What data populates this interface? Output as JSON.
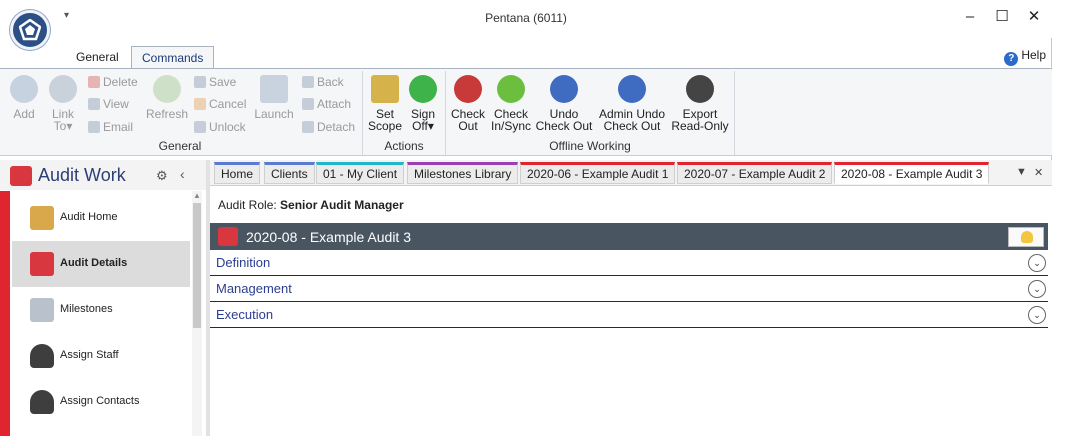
{
  "window": {
    "title": "Pentana (6011)",
    "qat_arrow": "▾",
    "minimize": "–",
    "maximize": "☐",
    "close": "✕"
  },
  "ribbon_tabs": [
    {
      "label": "General"
    },
    {
      "label": "Commands",
      "active": true
    }
  ],
  "help": {
    "label": "Help",
    "icon": "?"
  },
  "ribbon": {
    "general": {
      "label": "General",
      "add": "Add",
      "link_to": "Link To▾",
      "delete": "Delete",
      "view": "View",
      "email": "Email",
      "refresh": "Refresh",
      "save": "Save",
      "cancel": "Cancel",
      "unlock": "Unlock",
      "launch": "Launch",
      "back": "Back",
      "attach": "Attach",
      "detach": "Detach"
    },
    "actions": {
      "label": "Actions",
      "set_scope_1": "Set",
      "set_scope_2": "Scope",
      "sign_off_1": "Sign",
      "sign_off_2": "Off▾"
    },
    "offline": {
      "label": "Offline Working",
      "check_out_1": "Check",
      "check_out_2": "Out",
      "check_in_1": "Check",
      "check_in_2": "In/Sync",
      "undo_1": "Undo",
      "undo_2": "Check Out",
      "admin_undo_1": "Admin Undo",
      "admin_undo_2": "Check Out",
      "export_1": "Export",
      "export_2": "Read-Only"
    }
  },
  "nav": {
    "title": "Audit Work",
    "gear": "⚙",
    "collapse": "‹",
    "items": [
      {
        "label": "Audit Home"
      },
      {
        "label": "Audit Details",
        "active": true
      },
      {
        "label": "Milestones"
      },
      {
        "label": "Assign Staff"
      },
      {
        "label": "Assign Contacts"
      }
    ]
  },
  "doc_tabs": [
    {
      "label": "Home",
      "color": "#5b7bd0"
    },
    {
      "label": "Clients",
      "color": "#5b7bd0"
    },
    {
      "label": "01 - My Client",
      "color": "#20b7c9"
    },
    {
      "label": "Milestones Library",
      "color": "#9b3fb5"
    },
    {
      "label": "2020-06 - Example Audit 1",
      "color": "#e1252f"
    },
    {
      "label": "2020-07 - Example Audit 2",
      "color": "#e1252f"
    },
    {
      "label": "2020-08 - Example Audit 3",
      "color": "#e1252f",
      "active": true
    }
  ],
  "doc_tab_controls": {
    "dropdown": "▼",
    "close": "✕"
  },
  "content": {
    "audit_role_label": "Audit Role:",
    "audit_role_value": "Senior Audit Manager",
    "audit_title": "2020-08 - Example Audit 3",
    "sections": [
      {
        "label": "Definition",
        "expand": "⌄"
      },
      {
        "label": "Management",
        "expand": "⌄"
      },
      {
        "label": "Execution",
        "expand": "⌄"
      }
    ]
  }
}
